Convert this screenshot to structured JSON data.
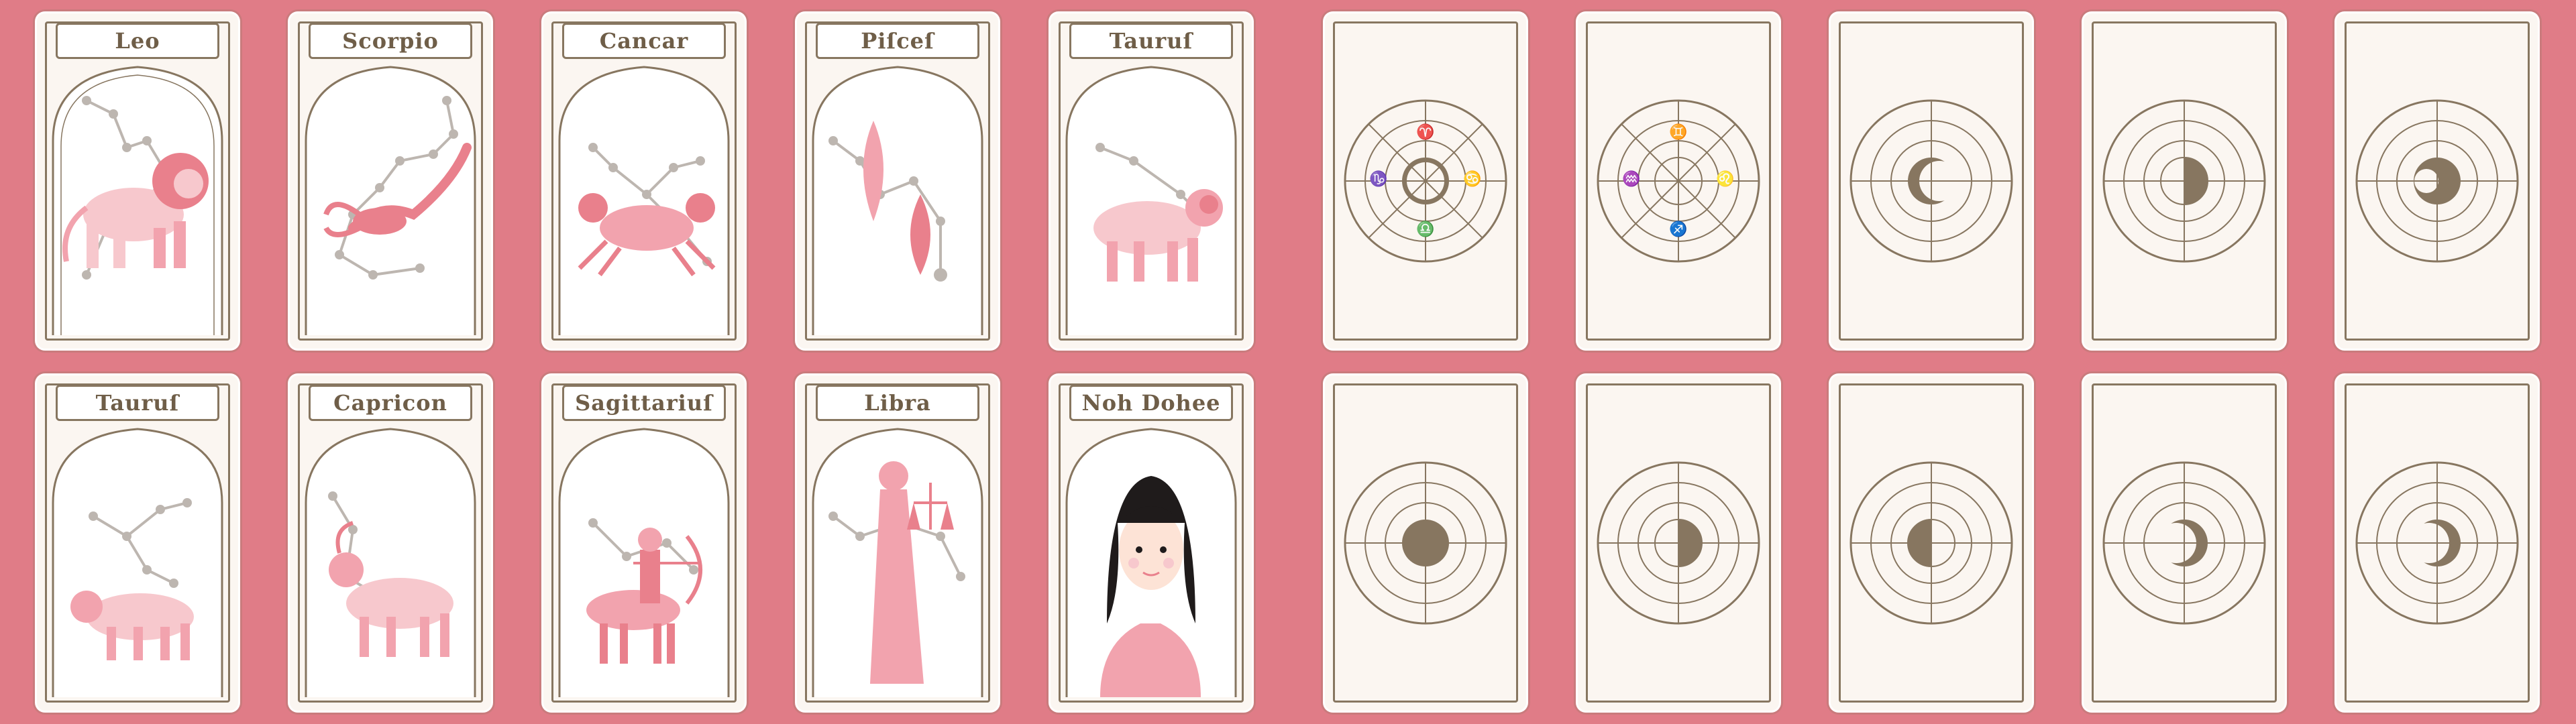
{
  "palette": {
    "background": "#e07c87",
    "frame": "#877660",
    "pink": "#f2a3ae",
    "light_pink": "#f7c8cd",
    "star_line": "#bdb6b0"
  },
  "front_cards": [
    {
      "title": "Leo",
      "figure": "lion"
    },
    {
      "title": "Scorpio",
      "figure": "scorpion"
    },
    {
      "title": "Cancar",
      "figure": "crab"
    },
    {
      "title": "Piſceſ",
      "figure": "fish"
    },
    {
      "title": "Tauruſ",
      "figure": "ram"
    },
    {
      "title": "Tauruſ",
      "figure": "bull"
    },
    {
      "title": "Capricon",
      "figure": "goat"
    },
    {
      "title": "Sagittariuſ",
      "figure": "centaur"
    },
    {
      "title": "Libra",
      "figure": "lady-with-scales"
    },
    {
      "title": "Noh Dohee",
      "figure": "portrait"
    }
  ],
  "back_cards": [
    {
      "moon": "full"
    },
    {
      "moon": "new"
    },
    {
      "moon": "crescent"
    },
    {
      "moon": "half"
    },
    {
      "moon": "gibbous"
    },
    {
      "moon": "full"
    },
    {
      "moon": "half"
    },
    {
      "moon": "half"
    },
    {
      "moon": "crescent"
    },
    {
      "moon": "crescent"
    }
  ],
  "zodiac_glyphs": [
    "♈",
    "♉",
    "♊",
    "♋",
    "♌",
    "♍",
    "♎",
    "♏",
    "♐",
    "♑",
    "♒",
    "♓"
  ]
}
